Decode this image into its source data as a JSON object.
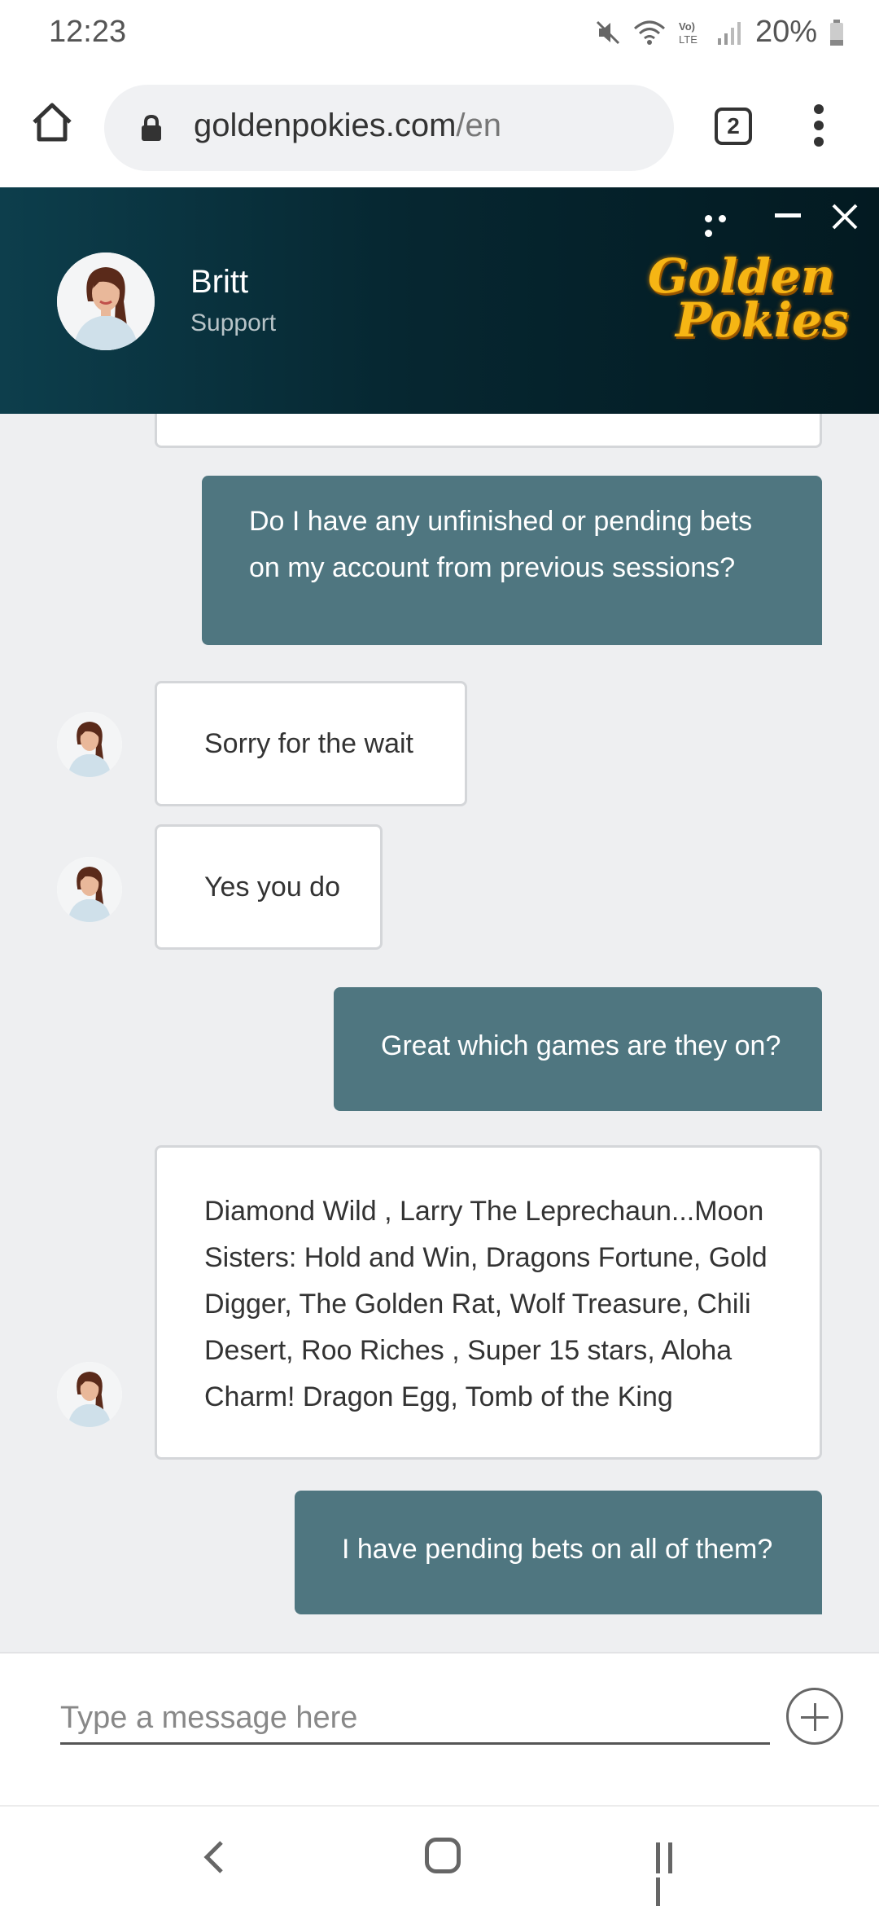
{
  "status_bar": {
    "time": "12:23",
    "battery": "20%",
    "icons": [
      "mute-icon",
      "wifi-icon",
      "volte-icon",
      "signal-icon",
      "battery-icon"
    ]
  },
  "browser": {
    "url_host": "goldenpokies.com",
    "url_path": "/en",
    "tab_count": "2"
  },
  "chat_header": {
    "agent_name": "Britt",
    "agent_role": "Support",
    "brand_line1": "Golden",
    "brand_line2": "Pokies"
  },
  "messages": [
    {
      "from": "user",
      "text": "Do I have any unfinished or pending bets on my account from previous sessions?"
    },
    {
      "from": "agent",
      "text": "Sorry for the wait"
    },
    {
      "from": "agent",
      "text": "Yes you do"
    },
    {
      "from": "user",
      "text": "Great which games are they on?"
    },
    {
      "from": "agent",
      "text": "Diamond Wild , Larry The Leprechaun...Moon Sisters: Hold and Win, Dragons Fortune, Gold Digger, The Golden Rat, Wolf Treasure, Chili Desert, Roo Riches , Super 15 stars, Aloha Charm! Dragon Egg, Tomb of the King"
    },
    {
      "from": "user",
      "text": "I have pending bets on all of them?"
    }
  ],
  "composer": {
    "placeholder": "Type a message here"
  },
  "colors": {
    "user_bubble": "#4f7680",
    "header_dark": "#062731",
    "brand_gold": "#f6b514"
  }
}
